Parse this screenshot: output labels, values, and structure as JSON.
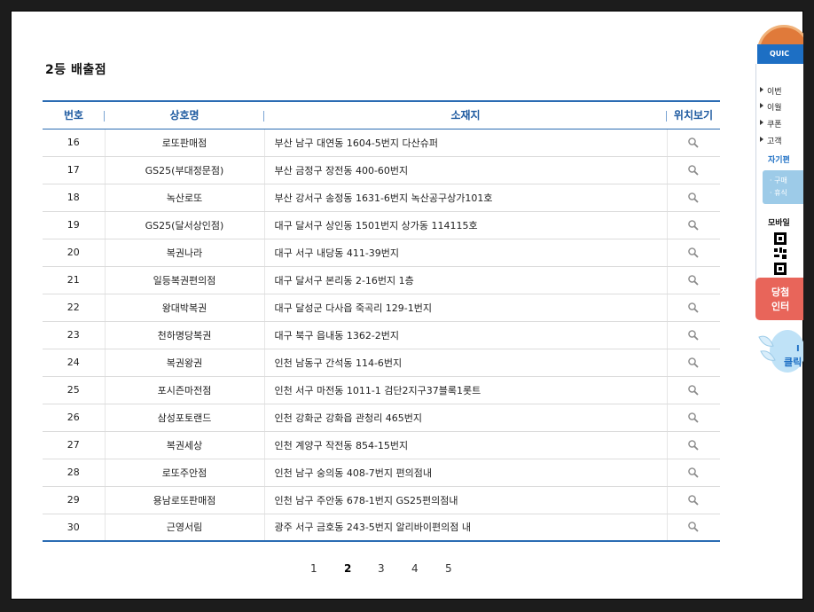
{
  "page": {
    "title": "2등 배출점"
  },
  "table": {
    "headers": {
      "number": "번호",
      "store_name": "상호명",
      "address": "소재지",
      "view_location": "위치보기"
    },
    "rows": [
      {
        "number": "16",
        "name": "로또판매점",
        "address": "부산 남구 대연동 1604-5번지 다산슈퍼"
      },
      {
        "number": "17",
        "name": "GS25(부대정문점)",
        "address": "부산 금정구 장전동 400-60번지"
      },
      {
        "number": "18",
        "name": "녹산로또",
        "address": "부산 강서구 송정동 1631-6번지 녹산공구상가101호"
      },
      {
        "number": "19",
        "name": "GS25(달서상인점)",
        "address": "대구 달서구 상인동 1501번지 상가동 114115호"
      },
      {
        "number": "20",
        "name": "복권나라",
        "address": "대구 서구 내당동 411-39번지"
      },
      {
        "number": "21",
        "name": "일등복권편의점",
        "address": "대구 달서구 본리동 2-16번지 1층"
      },
      {
        "number": "22",
        "name": "왕대박복권",
        "address": "대구 달성군 다사읍 죽곡리 129-1번지"
      },
      {
        "number": "23",
        "name": "천하명당복권",
        "address": "대구 북구 읍내동 1362-2번지"
      },
      {
        "number": "24",
        "name": "복권왕권",
        "address": "인천 남동구 간석동 114-6번지"
      },
      {
        "number": "25",
        "name": "포시즌마전점",
        "address": "인천 서구 마전동 1011-1 검단2지구37블록1롯트"
      },
      {
        "number": "26",
        "name": "삼성포토랜드",
        "address": "인천 강화군 강화읍 관청리 465번지"
      },
      {
        "number": "27",
        "name": "복권세상",
        "address": "인천 계양구 작전동 854-15번지"
      },
      {
        "number": "28",
        "name": "로또주안점",
        "address": "인천 남구 숭의동 408-7번지 편의점내"
      },
      {
        "number": "29",
        "name": "용남로또판매점",
        "address": "인천 남구 주안동 678-1번지 GS25편의점내"
      },
      {
        "number": "30",
        "name": "근영서림",
        "address": "광주 서구 금호동 243-5번지 알리바이편의점 내"
      }
    ]
  },
  "pagination": {
    "pages": [
      "1",
      "2",
      "3",
      "4",
      "5"
    ],
    "current": "2"
  },
  "quick_menu": {
    "header": "QUIC",
    "items": [
      "이번",
      "이월",
      "쿠폰",
      "고객"
    ],
    "section_label": "자기편",
    "blue_items": [
      "· 구매",
      "· 휴식"
    ],
    "mobile_label": "모바일",
    "red_lines": [
      "당첨",
      "인터"
    ],
    "bird_lines": [
      "I",
      "클릭"
    ]
  },
  "colors": {
    "accent": "#2b6cb3",
    "header_text": "#1e5aa0",
    "quick_red": "#e8655a"
  }
}
